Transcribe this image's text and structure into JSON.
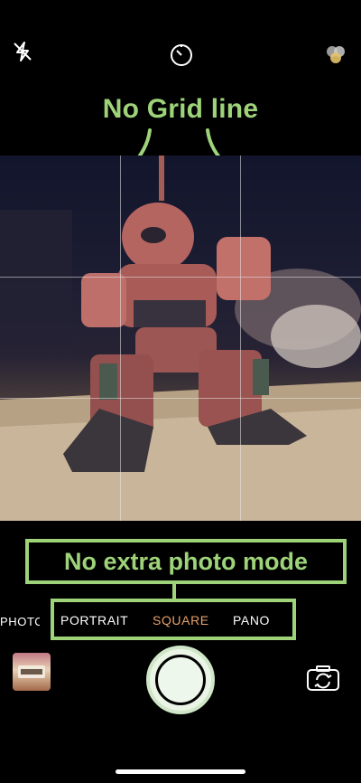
{
  "annotations": {
    "grid_prefix": "No ",
    "grid_strong": "Grid",
    "grid_suffix": " line",
    "mode_note": "No extra photo mode"
  },
  "camera_modes": {
    "photo_label": "PHOTO",
    "portrait_label": "PORTRAIT",
    "square_label": "SQUARE",
    "pano_label": "PANO",
    "selected": "SQUARE"
  },
  "colors": {
    "annotation_green": "#9ed37a",
    "selected_mode": "#e8a26b"
  },
  "icons": {
    "flash": "flash-off-icon",
    "timer": "timer-icon",
    "filters": "filters-icon",
    "switch": "switch-camera-icon"
  }
}
